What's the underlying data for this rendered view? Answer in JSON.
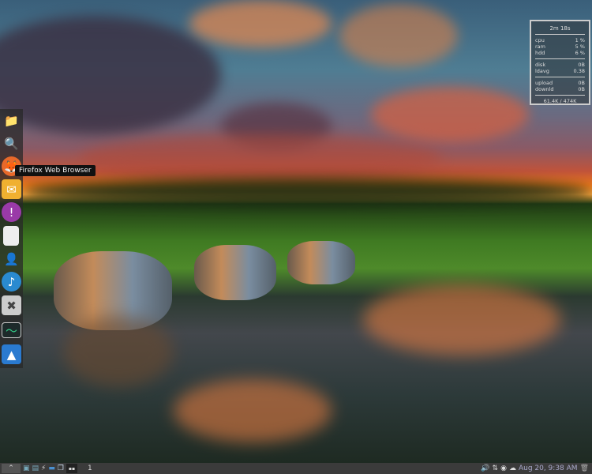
{
  "dock": {
    "items": [
      {
        "name": "file-manager",
        "icon": "folder-icon",
        "glyph": "📁",
        "bg": "#5a8ac6"
      },
      {
        "name": "search",
        "icon": "magnifier-icon",
        "glyph": "🔍",
        "bg": "transparent"
      },
      {
        "name": "firefox",
        "icon": "firefox-icon",
        "glyph": "🦊",
        "bg": "#e8692a"
      },
      {
        "name": "mail",
        "icon": "mail-icon",
        "glyph": "✉",
        "bg": "#f0b030"
      },
      {
        "name": "messenger",
        "icon": "chat-icon",
        "glyph": "!",
        "bg": "#9a3aa8"
      },
      {
        "name": "document",
        "icon": "document-icon",
        "glyph": "",
        "bg": "#eeeeee"
      },
      {
        "name": "users",
        "icon": "user-icon",
        "glyph": "👤",
        "bg": "transparent"
      },
      {
        "name": "music",
        "icon": "music-player-icon",
        "glyph": "♪",
        "bg": "#2a8ad0"
      },
      {
        "name": "settings",
        "icon": "tools-icon",
        "glyph": "✖",
        "bg": "#cccccc"
      },
      {
        "name": "system-monitor",
        "icon": "monitor-icon",
        "glyph": "〜",
        "bg": "#1d2a2a"
      },
      {
        "name": "software-center",
        "icon": "store-icon",
        "glyph": "▲",
        "bg": "#2a7ad0"
      }
    ],
    "tooltip": "Firefox Web Browser"
  },
  "conky": {
    "uptime": "2m 18s",
    "cpu_label": "cpu",
    "cpu": "1 %",
    "ram_label": "ram",
    "ram": "5 %",
    "hdd_label": "hdd",
    "hdd": "6 %",
    "disk_label": "disk",
    "disk": "0B",
    "ldavg_label": "ldavg",
    "ldavg": "0.38",
    "upload_label": "upload",
    "upload": "0B",
    "downld_label": "downld",
    "downld": "0B",
    "traffic": "61.4K / 474K"
  },
  "taskbar": {
    "workspace": "1",
    "clock": "Aug 20, 9:38 AM"
  }
}
